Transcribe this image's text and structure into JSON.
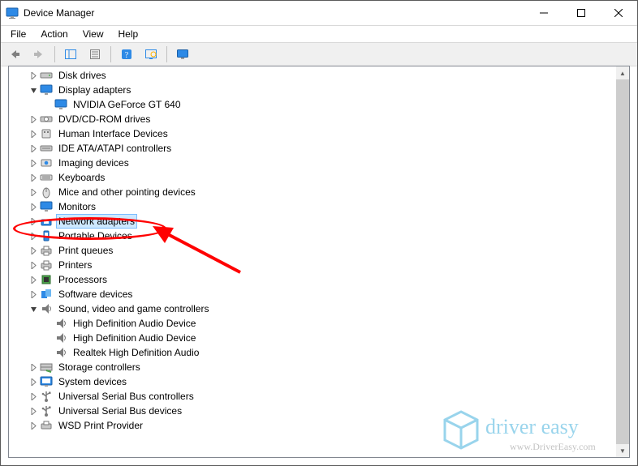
{
  "title": "Device Manager",
  "menu": [
    "File",
    "Action",
    "View",
    "Help"
  ],
  "watermark": {
    "brand": "driver easy",
    "url": "www.DriverEasy.com"
  },
  "iconset": {
    "disk": "<svg viewBox='0 0 16 16'><rect x='1' y='5' width='14' height='6' rx='1' fill='#c9c9c9' stroke='#7a7a7a'/><circle cx='12' cy='8' r='1' fill='#50b050'/></svg>",
    "display": "<svg viewBox='0 0 16 16'><rect x='1' y='2' width='14' height='9' rx='1' fill='#2e8ae6' stroke='#1b5fa6'/><rect x='6' y='12' width='4' height='2' fill='#a0a0a0'/></svg>",
    "dvd": "<svg viewBox='0 0 16 16'><rect x='1' y='5' width='14' height='6' rx='1' fill='#c9c9c9' stroke='#7a7a7a'/><circle cx='8' cy='8' r='2.5' fill='#fff' stroke='#7a7a7a'/></svg>",
    "hid": "<svg viewBox='0 0 16 16'><rect x='3' y='3' width='10' height='10' rx='1' fill='#e0e0e0' stroke='#7a7a7a'/><rect x='5' y='5' width='2' height='2' fill='#7a7a7a'/><rect x='9' y='5' width='2' height='2' fill='#7a7a7a'/></svg>",
    "ide": "<svg viewBox='0 0 16 16'><rect x='1' y='5' width='14' height='6' rx='1' fill='#c9c9c9' stroke='#7a7a7a'/><line x1='3' y1='8' x2='13' y2='8' stroke='#7a7a7a'/></svg>",
    "imaging": "<svg viewBox='0 0 16 16'><rect x='2' y='4' width='12' height='8' rx='1' fill='#e0e0e0' stroke='#7a7a7a'/><circle cx='8' cy='8' r='2.3' fill='#2e8ae6'/></svg>",
    "keyboard": "<svg viewBox='0 0 16 16'><rect x='1' y='5' width='14' height='6' rx='1' fill='#e0e0e0' stroke='#7a7a7a'/><line x1='3' y1='7' x2='13' y2='7' stroke='#7a7a7a'/><line x1='3' y1='9' x2='13' y2='9' stroke='#7a7a7a'/></svg>",
    "mouse": "<svg viewBox='0 0 16 16'><ellipse cx='8' cy='9' rx='4' ry='6' fill='#e0e0e0' stroke='#7a7a7a'/><line x1='8' y1='3' x2='8' y2='8' stroke='#7a7a7a'/></svg>",
    "monitor": "<svg viewBox='0 0 16 16'><rect x='1' y='2' width='14' height='9' rx='1' fill='#2e8ae6' stroke='#1b5fa6'/><rect x='6' y='12' width='4' height='2' fill='#a0a0a0'/></svg>",
    "network": "<svg viewBox='0 0 16 16'><rect x='2' y='6' width='12' height='7' rx='1' fill='#2e8ae6' stroke='#1b5fa6'/><rect x='5' y='8' width='6' height='3' fill='#fff'/></svg>",
    "portable": "<svg viewBox='0 0 16 16'><rect x='5' y='2' width='6' height='12' rx='1' fill='#2e8ae6' stroke='#1b5fa6'/><rect x='6' y='4' width='4' height='6' fill='#fff'/></svg>",
    "printer": "<svg viewBox='0 0 16 16'><rect x='2' y='6' width='12' height='6' rx='1' fill='#c9c9c9' stroke='#7a7a7a'/><rect x='5' y='3' width='6' height='4' fill='#fff' stroke='#7a7a7a'/><rect x='5' y='10' width='6' height='4' fill='#fff' stroke='#7a7a7a'/></svg>",
    "cpu": "<svg viewBox='0 0 16 16'><rect x='3' y='3' width='10' height='10' fill='#4aa04a' stroke='#2d6b2d'/><rect x='5' y='5' width='6' height='6' fill='#333'/></svg>",
    "software": "<svg viewBox='0 0 16 16'><rect x='2' y='4' width='7' height='9' fill='#2e8ae6'/><rect x='7' y='2' width='7' height='9' fill='#6db7f2'/></svg>",
    "sound": "<svg viewBox='0 0 16 16'><polygon points='3,6 7,6 11,2 11,14 7,10 3,10' fill='#7a7a7a'/><path d='M12 5 Q15 8 12 11' fill='none' stroke='#7a7a7a'/></svg>",
    "storage": "<svg viewBox='0 0 16 16'><rect x='1' y='4' width='14' height='4' fill='#c9c9c9' stroke='#7a7a7a'/><rect x='1' y='8' width='14' height='4' fill='#c9c9c9' stroke='#7a7a7a'/><line x1='8' y1='12' x2='14' y2='14' stroke='#4aa04a' stroke-width='2'/></svg>",
    "system": "<svg viewBox='0 0 16 16'><rect x='1' y='2' width='14' height='10' rx='1' fill='#2e8ae6' stroke='#1b5fa6'/><rect x='3' y='4' width='10' height='6' fill='#fff'/><rect x='6' y='12' width='4' height='2' fill='#a0a0a0'/></svg>",
    "usb": "<svg viewBox='0 0 16 16'><circle cx='8' cy='13' r='2' fill='#7a7a7a'/><line x1='8' y1='13' x2='8' y2='2' stroke='#7a7a7a' stroke-width='1.5'/><line x1='8' y1='8' x2='4' y2='5' stroke='#7a7a7a' stroke-width='1.5'/><line x1='8' y1='6' x2='12' y2='4' stroke='#7a7a7a' stroke-width='1.5'/><circle cx='4' cy='5' r='1.3' fill='#7a7a7a'/><rect x='11' y='2.5' width='2.5' height='2.5' fill='#7a7a7a'/></svg>",
    "wsd": "<svg viewBox='0 0 16 16'><rect x='2' y='6' width='12' height='6' rx='1' fill='#c9c9c9' stroke='#7a7a7a'/><rect x='5' y='3' width='6' height='4' fill='#fff' stroke='#7a7a7a'/></svg>"
  },
  "tree": [
    {
      "level": 1,
      "exp": "closed",
      "icon": "disk",
      "label": "Disk drives"
    },
    {
      "level": 1,
      "exp": "open",
      "icon": "display",
      "label": "Display adapters"
    },
    {
      "level": 2,
      "exp": "none",
      "icon": "display",
      "label": "NVIDIA GeForce GT 640"
    },
    {
      "level": 1,
      "exp": "closed",
      "icon": "dvd",
      "label": "DVD/CD-ROM drives"
    },
    {
      "level": 1,
      "exp": "closed",
      "icon": "hid",
      "label": "Human Interface Devices"
    },
    {
      "level": 1,
      "exp": "closed",
      "icon": "ide",
      "label": "IDE ATA/ATAPI controllers"
    },
    {
      "level": 1,
      "exp": "closed",
      "icon": "imaging",
      "label": "Imaging devices"
    },
    {
      "level": 1,
      "exp": "closed",
      "icon": "keyboard",
      "label": "Keyboards"
    },
    {
      "level": 1,
      "exp": "closed",
      "icon": "mouse",
      "label": "Mice and other pointing devices"
    },
    {
      "level": 1,
      "exp": "closed",
      "icon": "monitor",
      "label": "Monitors"
    },
    {
      "level": 1,
      "exp": "closed",
      "icon": "network",
      "label": "Network adapters",
      "selected": true
    },
    {
      "level": 1,
      "exp": "closed",
      "icon": "portable",
      "label": "Portable Devices"
    },
    {
      "level": 1,
      "exp": "closed",
      "icon": "printer",
      "label": "Print queues"
    },
    {
      "level": 1,
      "exp": "closed",
      "icon": "printer",
      "label": "Printers"
    },
    {
      "level": 1,
      "exp": "closed",
      "icon": "cpu",
      "label": "Processors"
    },
    {
      "level": 1,
      "exp": "closed",
      "icon": "software",
      "label": "Software devices"
    },
    {
      "level": 1,
      "exp": "open",
      "icon": "sound",
      "label": "Sound, video and game controllers"
    },
    {
      "level": 2,
      "exp": "none",
      "icon": "sound",
      "label": "High Definition Audio Device"
    },
    {
      "level": 2,
      "exp": "none",
      "icon": "sound",
      "label": "High Definition Audio Device"
    },
    {
      "level": 2,
      "exp": "none",
      "icon": "sound",
      "label": "Realtek High Definition Audio"
    },
    {
      "level": 1,
      "exp": "closed",
      "icon": "storage",
      "label": "Storage controllers"
    },
    {
      "level": 1,
      "exp": "closed",
      "icon": "system",
      "label": "System devices"
    },
    {
      "level": 1,
      "exp": "closed",
      "icon": "usb",
      "label": "Universal Serial Bus controllers"
    },
    {
      "level": 1,
      "exp": "closed",
      "icon": "usb",
      "label": "Universal Serial Bus devices"
    },
    {
      "level": 1,
      "exp": "closed",
      "icon": "wsd",
      "label": "WSD Print Provider"
    }
  ]
}
